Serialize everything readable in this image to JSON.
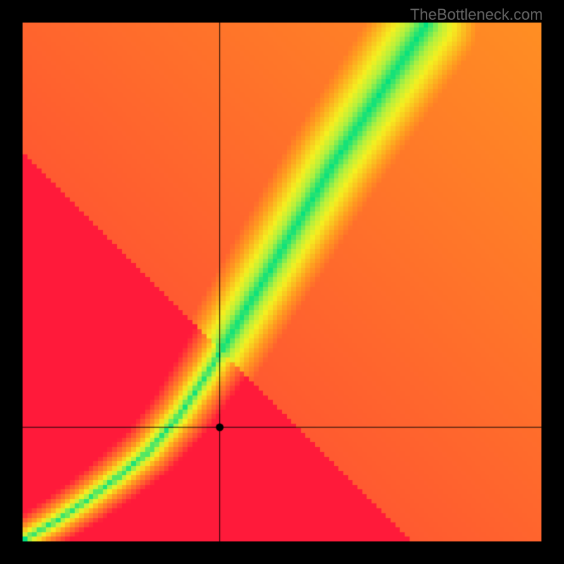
{
  "watermark": "TheBottleneck.com",
  "chart_data": {
    "type": "heatmap",
    "title": "",
    "xlabel": "",
    "ylabel": "",
    "xlim": [
      0,
      100
    ],
    "ylim": [
      0,
      100
    ],
    "marker": {
      "x": 38,
      "y": 22
    },
    "crosshair": {
      "x": 38,
      "y": 22
    },
    "ideal_curve_description": "Green band follows a nonlinear curve from bottom-left to upper-right; distance from this curve maps to a red→orange→yellow→green→yellow color scale. Upper-right region biases toward yellow/orange; left and bottom bias toward red.",
    "color_stops": [
      {
        "t": 0.0,
        "color": "#00e080"
      },
      {
        "t": 0.18,
        "color": "#b0f040"
      },
      {
        "t": 0.32,
        "color": "#f5f020"
      },
      {
        "t": 0.55,
        "color": "#ff9a20"
      },
      {
        "t": 0.78,
        "color": "#ff5a30"
      },
      {
        "t": 1.0,
        "color": "#ff1a3a"
      }
    ],
    "curve_points": [
      {
        "x": 0.0,
        "y": 0.0
      },
      {
        "x": 0.06,
        "y": 0.035
      },
      {
        "x": 0.12,
        "y": 0.075
      },
      {
        "x": 0.18,
        "y": 0.12
      },
      {
        "x": 0.24,
        "y": 0.17
      },
      {
        "x": 0.3,
        "y": 0.24
      },
      {
        "x": 0.36,
        "y": 0.33
      },
      {
        "x": 0.42,
        "y": 0.43
      },
      {
        "x": 0.48,
        "y": 0.53
      },
      {
        "x": 0.54,
        "y": 0.63
      },
      {
        "x": 0.6,
        "y": 0.73
      },
      {
        "x": 0.66,
        "y": 0.82
      },
      {
        "x": 0.72,
        "y": 0.91
      },
      {
        "x": 0.78,
        "y": 1.0
      }
    ]
  }
}
